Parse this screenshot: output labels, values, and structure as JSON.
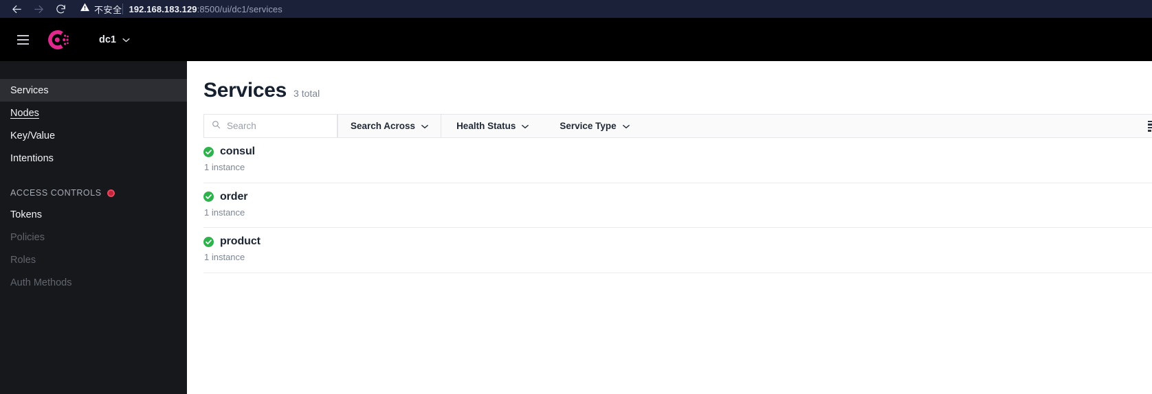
{
  "browser": {
    "back_icon": "arrow-left-icon",
    "forward_icon": "arrow-right-icon",
    "reload_icon": "reload-icon",
    "warning_icon": "warning-triangle-icon",
    "security_label": "不安全",
    "url_host": "192.168.183.129",
    "url_path": ":8500/ui/dc1/services",
    "chrome_bg": "#1b2138"
  },
  "app_header": {
    "menu_icon": "hamburger-menu-icon",
    "logo_icon": "consul-logo-icon",
    "logo_color": "#e0288d",
    "datacenter": "dc1",
    "datacenter_chevron": "chevron-down-icon",
    "bg": "#000000"
  },
  "sidebar": {
    "bg": "#17181c",
    "active_bg": "#2d2e33",
    "items": [
      {
        "label": "Services",
        "state": "active"
      },
      {
        "label": "Nodes",
        "state": "hovered"
      },
      {
        "label": "Key/Value",
        "state": "normal"
      },
      {
        "label": "Intentions",
        "state": "normal"
      }
    ],
    "section": {
      "label": "ACCESS CONTROLS",
      "badge_icon": "alert-dot-icon",
      "badge_color": "#c0233a"
    },
    "acl_items": [
      {
        "label": "Tokens",
        "state": "normal"
      },
      {
        "label": "Policies",
        "state": "disabled"
      },
      {
        "label": "Roles",
        "state": "disabled"
      },
      {
        "label": "Auth Methods",
        "state": "disabled"
      }
    ]
  },
  "main": {
    "title": "Services",
    "subtitle": "3 total",
    "toolbar": {
      "search_icon": "search-icon",
      "search_value": "",
      "search_placeholder": "Search",
      "filters": [
        {
          "label": "Search Across",
          "icon": "chevron-down-icon"
        },
        {
          "label": "Health Status",
          "icon": "chevron-down-icon"
        },
        {
          "label": "Service Type",
          "icon": "chevron-down-icon"
        }
      ],
      "sort_icon": "sort-list-icon"
    },
    "services": [
      {
        "name": "consul",
        "status_icon": "check-circle-icon",
        "status_color": "#2eb24c",
        "instances": "1 instance"
      },
      {
        "name": "order",
        "status_icon": "check-circle-icon",
        "status_color": "#2eb24c",
        "instances": "1 instance"
      },
      {
        "name": "product",
        "status_icon": "check-circle-icon",
        "status_color": "#2eb24c",
        "instances": "1 instance"
      }
    ]
  }
}
